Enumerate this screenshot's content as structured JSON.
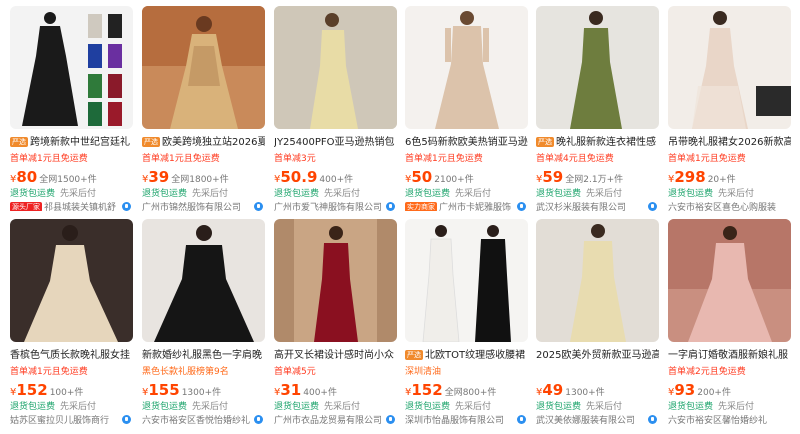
{
  "products": [
    {
      "title": "跨境新款中世纪宫廷礼",
      "tag": "严选",
      "promo": "首单减1元且免运费",
      "yen": "¥",
      "price": "80",
      "sales": "全网1500+件",
      "service": "退货包运费",
      "service2": "先采后付",
      "shop": "祁县城装关镇机舒",
      "badge": "源头厂家",
      "badge_color": "#e22"
    },
    {
      "title": "欧美跨境独立站2026夏",
      "tag": "严选",
      "promo": "首单减1元且免运费",
      "yen": "¥",
      "price": "39",
      "sales": "全网1800+件",
      "service": "退货包运费",
      "service2": "先采后付",
      "shop": "广州市锦然服饰有限公司",
      "badge": "",
      "badge_color": ""
    },
    {
      "title": "JY25400PFO亚马逊热销包",
      "tag": "",
      "promo": "首单减3元",
      "yen": "¥",
      "price": "50.9",
      "sales": "400+件",
      "service": "退货包运费",
      "service2": "先采后付",
      "shop": "广州市爱飞神服饰有限公司",
      "badge": "",
      "badge_color": ""
    },
    {
      "title": "6色5码新款欧美热销亚马逊",
      "tag": "",
      "promo": "首单减1元且免运费",
      "yen": "¥",
      "price": "50",
      "sales": "2100+件",
      "service": "退货包运费",
      "service2": "先采后付",
      "shop": "广州市卡妮雅服饰",
      "badge": "实力商家",
      "badge_color": "#ff6a1a"
    },
    {
      "title": "晚礼服新款连衣裙性感",
      "tag": "严选",
      "promo": "首单减4元且免运费",
      "yen": "¥",
      "price": "59",
      "sales": "全网2.1万+件",
      "service": "退货包运费",
      "service2": "先采后付",
      "shop": "武汉杉米服装有限公司",
      "badge": "",
      "badge_color": ""
    },
    {
      "title": "吊带晚礼服裙女2026新款高",
      "tag": "",
      "promo": "首单减1元且免运费",
      "yen": "¥",
      "price": "298",
      "sales": "20+件",
      "service": "退货包运费",
      "service2": "先采后付",
      "shop": "六安市裕安区喜色心购服装",
      "badge": "",
      "badge_color": ""
    },
    {
      "title": "香槟色气质长款晚礼服女挂",
      "tag": "",
      "promo": "首单减1元且免运费",
      "yen": "¥",
      "price": "152",
      "sales": "100+件",
      "service": "退货包运费",
      "service2": "先采后付",
      "shop": "姑苏区蜜拉贝儿服饰商行",
      "badge": "",
      "badge_color": ""
    },
    {
      "title": "新款婚纱礼服黑色一字肩晚",
      "tag": "",
      "promo": "黑色长款礼服榜第9名",
      "yen": "¥",
      "price": "155",
      "sales": "1300+件",
      "service": "退货包运费",
      "service2": "先采后付",
      "shop": "六安市裕安区香悦怡婚纱礼",
      "badge": "",
      "badge_color": ""
    },
    {
      "title": "高开叉长裙设计感时尚小众",
      "tag": "",
      "promo": "首单减5元",
      "yen": "¥",
      "price": "31",
      "sales": "400+件",
      "service": "退货包运费",
      "service2": "先采后付",
      "shop": "广州市衣品龙贸易有限公司",
      "badge": "",
      "badge_color": ""
    },
    {
      "title": "北欧TOT纹理感收腰裙",
      "tag": "严选",
      "promo": "深圳清油",
      "yen": "¥",
      "price": "152",
      "sales": "全网800+件",
      "service": "退货包运费",
      "service2": "先采后付",
      "shop": "深圳市怡晶服饰有限公司",
      "badge": "",
      "badge_color": ""
    },
    {
      "title": "2025欧美外贸新款亚马逊高",
      "tag": "",
      "promo": "",
      "yen": "¥",
      "price": "49",
      "sales": "1300+件",
      "service": "退货包运费",
      "service2": "先采后付",
      "shop": "武汉美依娜服装有限公司",
      "badge": "",
      "badge_color": ""
    },
    {
      "title": "一字肩订婚敬酒服新娘礼服",
      "tag": "",
      "promo": "首单减2元且免运费",
      "yen": "¥",
      "price": "93",
      "sales": "200+件",
      "service": "退货包运费",
      "service2": "先采后付",
      "shop": "六安市裕安区馨怡婚纱礼",
      "badge": "",
      "badge_color": ""
    }
  ],
  "colors": {
    "price": "#ff4400",
    "promo": "#ff3a1f",
    "service": "#1aa36a",
    "tag": "#f08a2c"
  }
}
